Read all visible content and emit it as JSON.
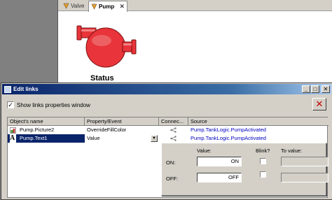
{
  "tabs": [
    {
      "label": "Valve",
      "icon": "valve-icon"
    },
    {
      "label": "Pump",
      "icon": "pump-icon",
      "close": "✕"
    }
  ],
  "canvas": {
    "status_label": "Status",
    "pump_color": "#e8343a"
  },
  "edit_links": {
    "title": "Edit links",
    "title_buttons": [
      "_",
      "□",
      "✕"
    ],
    "show_links_label": "Show links properties window",
    "show_links_checked": true,
    "delete_button": "✕",
    "columns": [
      "Object's name",
      "Property/Event",
      "Connec...",
      "Source"
    ],
    "rows": [
      {
        "icon": "picture-icon",
        "name": "Pump.Picture2",
        "property": "OverrideFillColor",
        "connection_icon": "link-icon",
        "source": "Pump.TankLogic.PumpActivated"
      },
      {
        "icon": "text-icon",
        "icon_glyph": "A",
        "name": "Pump.Text1",
        "property": "Value",
        "connection_icon": "link-icon",
        "source": "Pump.TankLogic.PumpActivated",
        "selected": true
      }
    ],
    "value_panel": {
      "value_header": "Value:",
      "blink_header": "Blink?",
      "to_value_header": "To value:",
      "on_label": "ON:",
      "on_value": "ON",
      "off_label": "OFF:",
      "off_value": "OFF"
    }
  }
}
